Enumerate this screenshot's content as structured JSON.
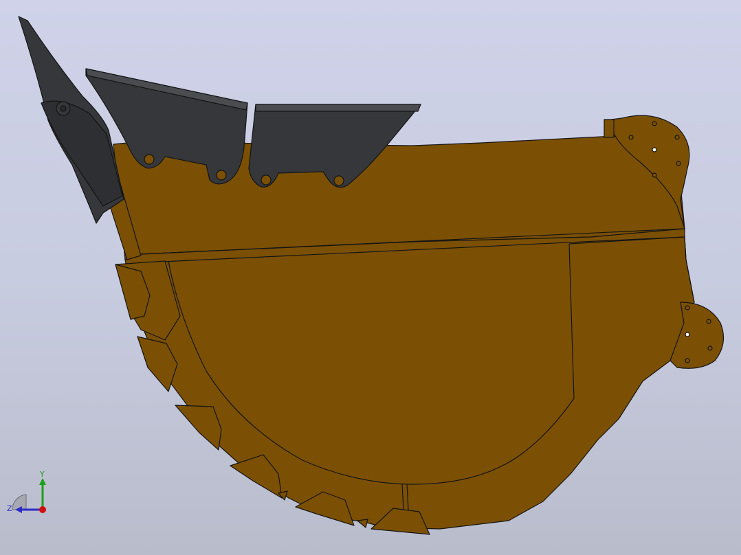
{
  "viewport": {
    "background_top": "#cfd2e8",
    "background_bottom": "#b9bccb"
  },
  "model": {
    "bucket_color": "#7b5004",
    "tooth_color": "#35373a",
    "edge_color": "#141414"
  },
  "triad": {
    "y_label": "Y",
    "z_label": "Z",
    "y_color": "#1aa01a",
    "z_color": "#2a2ac8",
    "x_color": "#d01010"
  }
}
